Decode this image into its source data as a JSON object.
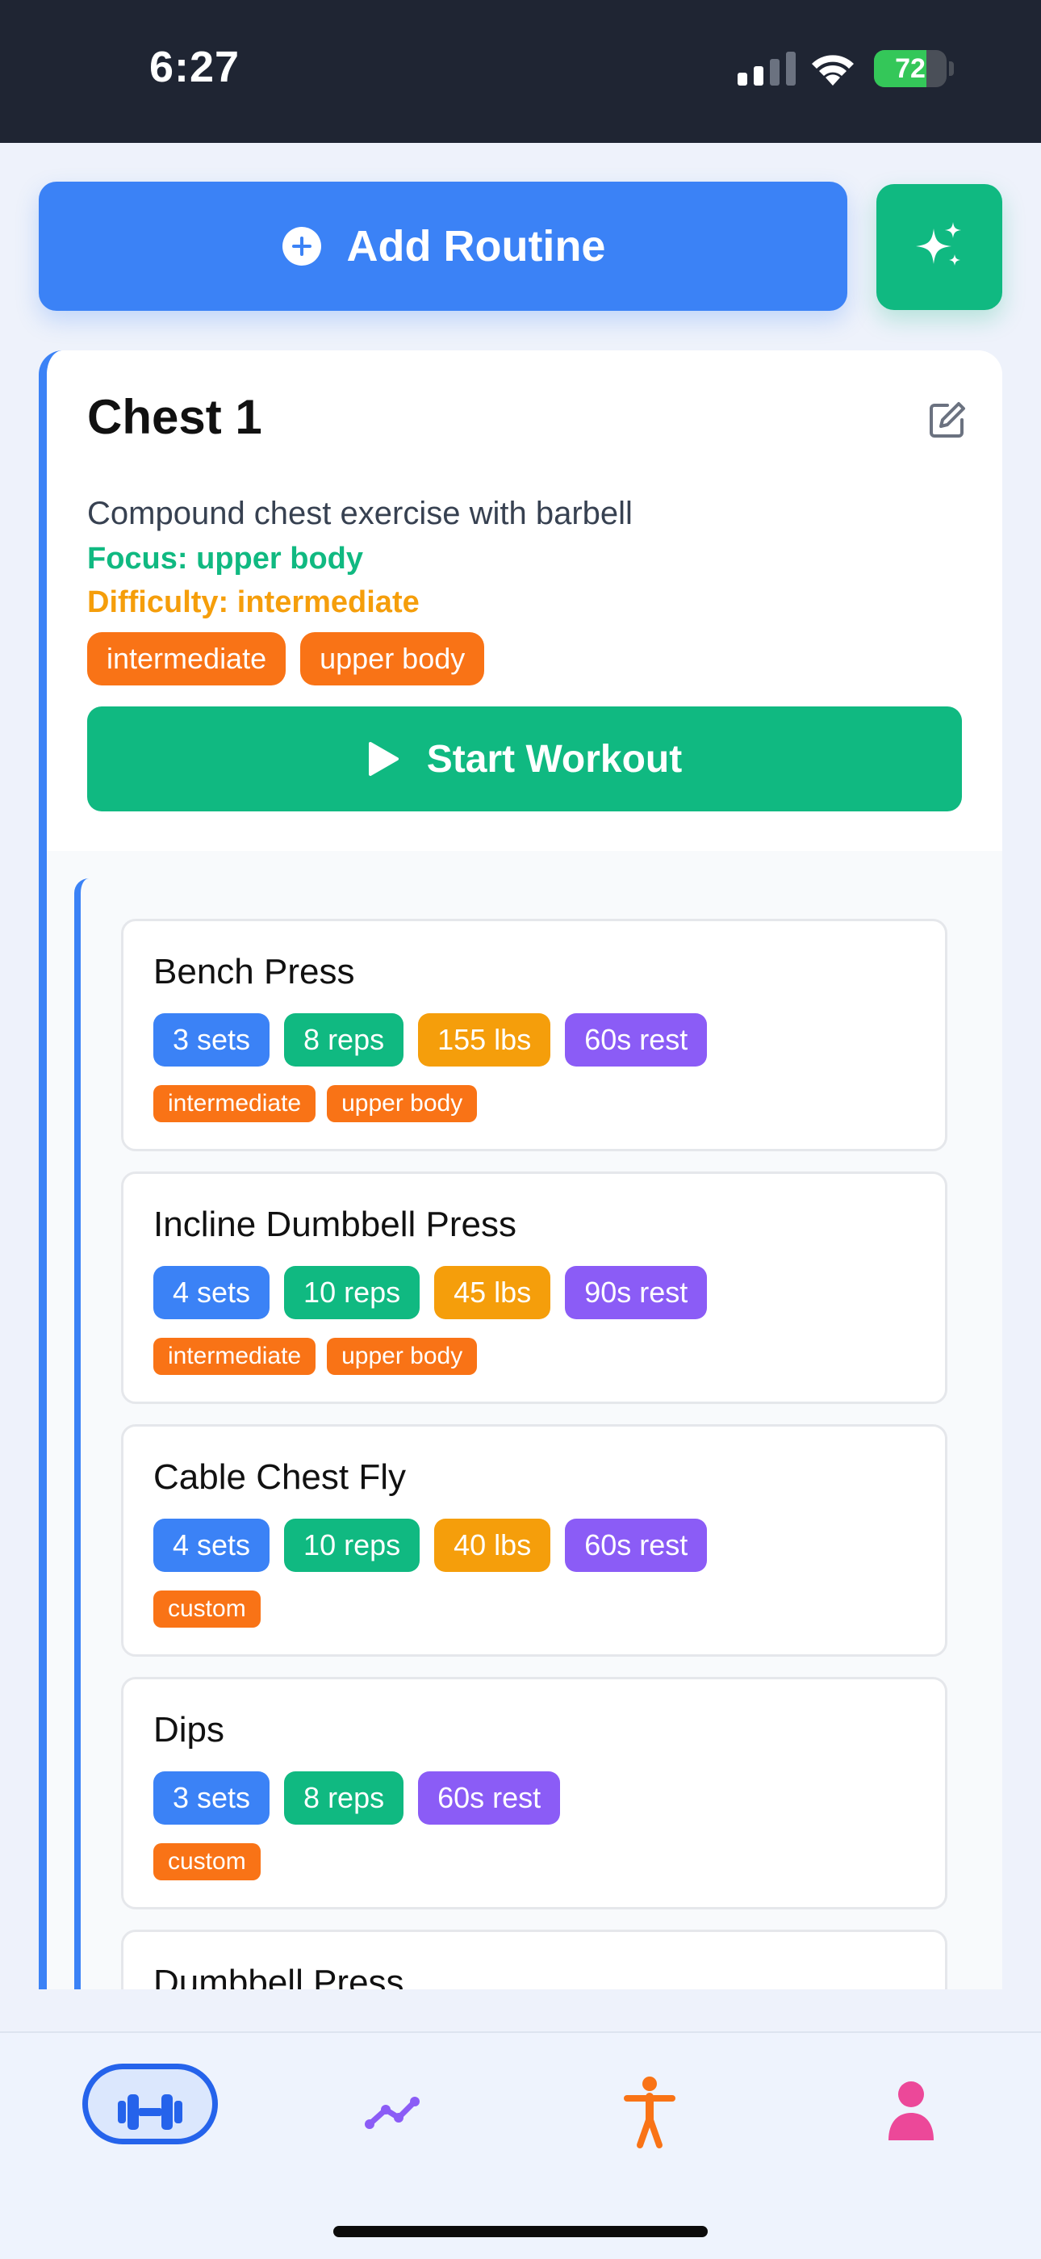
{
  "status_bar": {
    "time": "6:27",
    "battery": "72",
    "battery_level": 0.72
  },
  "toolbar": {
    "add_routine_label": "Add Routine"
  },
  "routine": {
    "title": "Chest 1",
    "description": "Compound chest exercise with barbell",
    "focus": "Focus: upper body",
    "difficulty": "Difficulty: intermediate",
    "tags": [
      "intermediate",
      "upper body"
    ],
    "start_label": "Start Workout"
  },
  "exercises": [
    {
      "name": "Bench Press",
      "sets": "3 sets",
      "reps": "8 reps",
      "weight": "155 lbs",
      "rest": "60s rest",
      "tags": [
        "intermediate",
        "upper body"
      ]
    },
    {
      "name": "Incline Dumbbell Press",
      "sets": "4 sets",
      "reps": "10 reps",
      "weight": "45 lbs",
      "rest": "90s rest",
      "tags": [
        "intermediate",
        "upper body"
      ]
    },
    {
      "name": "Cable Chest Fly",
      "sets": "4 sets",
      "reps": "10 reps",
      "weight": "40 lbs",
      "rest": "60s rest",
      "tags": [
        "custom"
      ]
    },
    {
      "name": "Dips",
      "sets": "3 sets",
      "reps": "8 reps",
      "rest": "60s rest",
      "tags": [
        "custom"
      ]
    },
    {
      "name": "Dumbbell Press"
    }
  ],
  "nav": {
    "items": [
      {
        "icon": "dumbbell-icon",
        "active": true,
        "color": "#2563eb"
      },
      {
        "icon": "trend-chart-icon",
        "active": false,
        "color": "#8b5cf6"
      },
      {
        "icon": "body-figure-icon",
        "active": false,
        "color": "#f97316"
      },
      {
        "icon": "person-icon",
        "active": false,
        "color": "#ec4899"
      }
    ]
  },
  "colors": {
    "primary": "#3b82f6",
    "success": "#10b981",
    "warning": "#f59e0b",
    "accent": "#8b5cf6",
    "tag": "#f97316"
  }
}
